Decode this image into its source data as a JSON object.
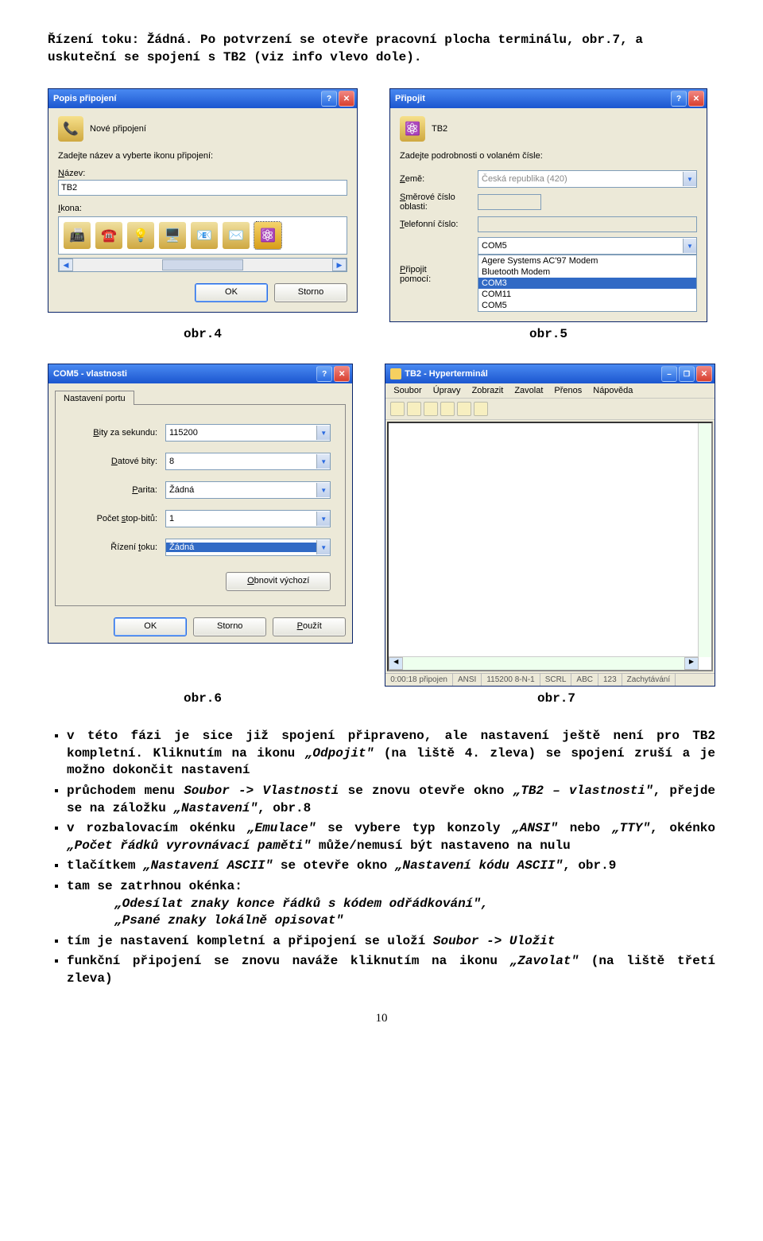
{
  "intro": {
    "label": "Řízení toku:",
    "value": "Žádná.",
    "rest": " Po potvrzení se otevře pracovní plocha terminálu, obr.7, a uskuteční se spojení s TB2 (viz info vlevo dole)."
  },
  "dlg4": {
    "title": "Popis připojení",
    "header": "Nové připojení",
    "prompt": "Zadejte název a vyberte ikonu připojení:",
    "name_label": "Název:",
    "name_value": "TB2",
    "icon_label": "Ikona:",
    "ok": "OK",
    "cancel": "Storno"
  },
  "dlg5": {
    "title": "Připojit",
    "conn_name": "TB2",
    "prompt": "Zadejte podrobnosti o volaném čísle:",
    "country_label": "Země:",
    "country_value": "Česká republika (420)",
    "area_label": "Směrové číslo oblasti:",
    "phone_label": "Telefonní číslo:",
    "connect_label": "Připojit pomocí:",
    "connect_value": "COM5",
    "options": [
      "Agere Systems AC'97 Modem",
      "Bluetooth Modem",
      "COM3",
      "COM11",
      "COM5"
    ]
  },
  "dlg6": {
    "title": "COM5 - vlastnosti",
    "tab": "Nastavení portu",
    "bits_label": "Bity za sekundu:",
    "bits": "115200",
    "data_label": "Datové bity:",
    "data": "8",
    "parity_label": "Parita:",
    "parity": "Žádná",
    "stop_label": "Počet stop-bitů:",
    "stop": "1",
    "flow_label": "Řízení toku:",
    "flow": "Žádná",
    "restore": "Obnovit výchozí",
    "ok": "OK",
    "cancel": "Storno",
    "apply": "Použít"
  },
  "dlg7": {
    "title": "TB2 - Hyperterminál",
    "menu": [
      "Soubor",
      "Úpravy",
      "Zobrazit",
      "Zavolat",
      "Přenos",
      "Nápověda"
    ],
    "status": [
      "0:00:18 připojen",
      "ANSI",
      "115200 8-N-1",
      "SCRL",
      "ABC",
      "123",
      "Zachytávání"
    ]
  },
  "captions": {
    "c4": "obr.4",
    "c5": "obr.5",
    "c6": "obr.6",
    "c7": "obr.7"
  },
  "bullets": {
    "b1a": "v této fázi je sice již spojení připraveno, ale nastavení ještě není pro TB2 kompletní. Kliknutím na ikonu ",
    "b1b": "„Odpojit\"",
    "b1c": " (na liště 4. zleva) se spojení zruší a je možno dokončit nastavení",
    "b2a": "průchodem menu ",
    "b2b": "Soubor -> Vlastnosti",
    "b2c": " se znovu otevře okno ",
    "b2d": "„TB2 – vlastnosti\"",
    "b2e": ", přejde se na záložku ",
    "b2f": "„Nastavení\"",
    "b2g": ", obr.8",
    "b3a": "v rozbalovacím okénku ",
    "b3b": "„Emulace\"",
    "b3c": " se vybere typ konzoly ",
    "b3d": "„ANSI\"",
    "b3e": " nebo ",
    "b3f": "„TTY\"",
    "b3g": ", okénko ",
    "b3h": "„Počet řádků vyrovnávací paměti\"",
    "b3i": " může/nemusí být nastaveno na nulu",
    "b4a": "tlačítkem ",
    "b4b": "„Nastavení ASCII\"",
    "b4c": " se otevře okno ",
    "b4d": "„Nastavení kódu ASCII\"",
    "b4e": ", obr.9",
    "b5": "tam se zatrhnou okénka:",
    "b5s1": "„Odesílat znaky konce řádků s kódem odřádkování\",",
    "b5s2": "„Psané znaky lokálně opisovat\"",
    "b6a": "tím je nastavení kompletní a připojení se uloží ",
    "b6b": "Soubor -> Uložit",
    "b7a": "funkční připojení se znovu naváže kliknutím na ikonu ",
    "b7b": "„Zavolat\"",
    "b7c": " (na liště třetí zleva)"
  },
  "pagenum": "10"
}
